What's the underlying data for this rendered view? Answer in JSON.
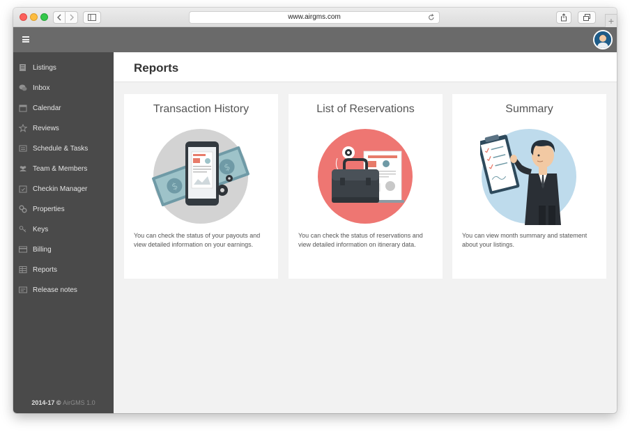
{
  "browser": {
    "url": "www.airgms.com",
    "new_tab_label": "+"
  },
  "sidebar": {
    "items": [
      {
        "label": "Listings",
        "icon": "listings-icon"
      },
      {
        "label": "Inbox",
        "icon": "inbox-icon"
      },
      {
        "label": "Calendar",
        "icon": "calendar-icon"
      },
      {
        "label": "Reviews",
        "icon": "star-icon"
      },
      {
        "label": "Schedule & Tasks",
        "icon": "schedule-icon"
      },
      {
        "label": "Team & Members",
        "icon": "team-icon"
      },
      {
        "label": "Checkin Manager",
        "icon": "checkin-icon"
      },
      {
        "label": "Properties",
        "icon": "properties-icon"
      },
      {
        "label": "Keys",
        "icon": "key-icon"
      },
      {
        "label": "Billing",
        "icon": "billing-icon"
      },
      {
        "label": "Reports",
        "icon": "reports-icon"
      },
      {
        "label": "Release notes",
        "icon": "release-notes-icon"
      }
    ],
    "footer_year": "2014-17 ©",
    "footer_brand": "AirGMS 1.0"
  },
  "page": {
    "title": "Reports"
  },
  "cards": [
    {
      "title": "Transaction History",
      "description": "You can check the status of your payouts and view detailed information on your earnings.",
      "icon": "money-phone-illustration"
    },
    {
      "title": "List of Reservations",
      "description": "You can check the status of reservations and view detailed information on itinerary data.",
      "icon": "briefcase-illustration"
    },
    {
      "title": "Summary",
      "description": "You can view month summary and statement about your listings.",
      "icon": "businessman-clipboard-illustration"
    }
  ],
  "colors": {
    "sidebar_bg": "#4a4a4a",
    "topbar_bg": "#6a6a6a",
    "content_bg": "#f2f2f2",
    "circle_gray": "#d3d3d3",
    "circle_red": "#ee7672",
    "circle_blue": "#bedbec"
  }
}
